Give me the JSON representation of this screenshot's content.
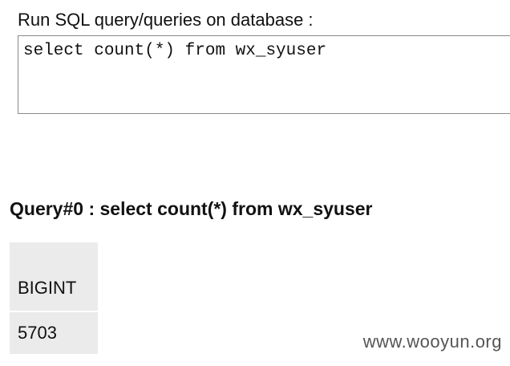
{
  "query_form": {
    "label": "Run SQL query/queries on database :",
    "sql_text": "select count(*) from wx_syuser"
  },
  "result": {
    "heading": "Query#0 : select count(*) from wx_syuser",
    "columns": [
      "BIGINT"
    ],
    "rows": [
      [
        "5703"
      ]
    ]
  },
  "watermark": "www.wooyun.org"
}
